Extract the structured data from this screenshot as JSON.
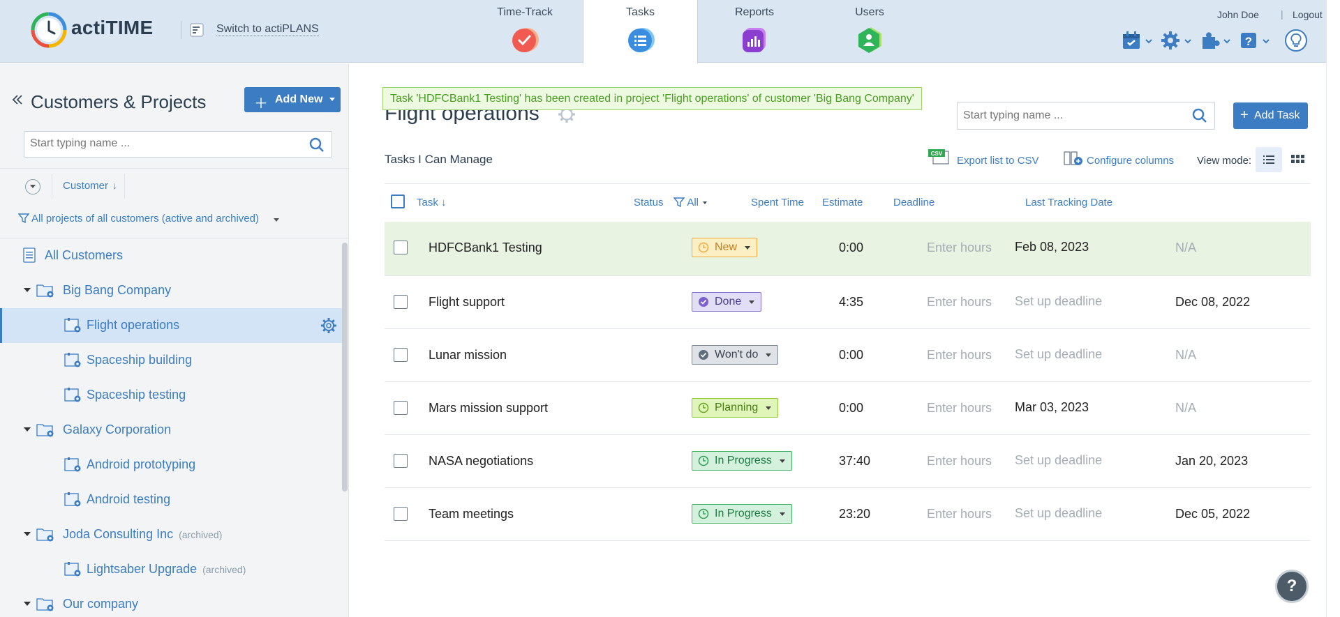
{
  "header": {
    "app_name": "actiTIME",
    "switch_link": "Switch to actiPLANS",
    "tabs": [
      {
        "label": "Time-Track",
        "color": "#f15a50"
      },
      {
        "label": "Tasks",
        "color": "#3b8de0"
      },
      {
        "label": "Reports",
        "color": "#8a3fd1"
      },
      {
        "label": "Users",
        "color": "#2fb45a"
      }
    ],
    "active_tab": "Tasks",
    "user_name": "John Doe",
    "separator": "|",
    "logout": "Logout",
    "tools": [
      "calendar-icon",
      "settings-icon",
      "addons-icon",
      "help-icon",
      "lightbulb-icon"
    ]
  },
  "sidebar": {
    "title": "Customers & Projects",
    "add_new": "Add New",
    "search_placeholder": "Start typing name ...",
    "sort_label": "Customer",
    "sort_arrow": "↓",
    "filter_label": "All projects of all customers (active and archived)",
    "tree": [
      {
        "label": "All Customers",
        "type": "all"
      },
      {
        "label": "Big Bang Company",
        "type": "customer"
      },
      {
        "label": "Flight operations",
        "type": "project",
        "selected": true
      },
      {
        "label": "Spaceship building",
        "type": "project"
      },
      {
        "label": "Spaceship testing",
        "type": "project"
      },
      {
        "label": "Galaxy Corporation",
        "type": "customer"
      },
      {
        "label": "Android prototyping",
        "type": "project"
      },
      {
        "label": "Android testing",
        "type": "project"
      },
      {
        "label": "Joda Consulting Inc",
        "type": "customer",
        "archived": "(archived)"
      },
      {
        "label": "Lightsaber Upgrade",
        "type": "project",
        "archived": "(archived)"
      },
      {
        "label": "Our company",
        "type": "customer"
      }
    ]
  },
  "main": {
    "page_title": "Flight operations",
    "toast": "Task 'HDFCBank1 Testing' has been created in project 'Flight operations' of customer 'Big Bang Company'",
    "search_placeholder": "Start typing name ...",
    "add_task": "Add Task",
    "list_title": "Tasks I Can Manage",
    "export_label": "Export list to CSV",
    "export_badge": "CSV",
    "configure_label": "Configure columns",
    "view_mode_label": "View mode:",
    "columns": {
      "task": "Task",
      "task_sort": "↓",
      "status": "Status",
      "status_filter": "All",
      "spent": "Spent Time",
      "estimate": "Estimate",
      "deadline": "Deadline",
      "last_tracking": "Last Tracking Date"
    },
    "rows": [
      {
        "task": "HDFCBank1 Testing",
        "status": "New",
        "status_kind": "new",
        "spent": "0:00",
        "estimate": "Enter hours",
        "deadline": "Feb 08, 2023",
        "last_tracking": "N/A",
        "highlight": true
      },
      {
        "task": "Flight support",
        "status": "Done",
        "status_kind": "done",
        "spent": "4:35",
        "estimate": "Enter hours",
        "deadline": "Set up deadline",
        "last_tracking": "Dec 08, 2022"
      },
      {
        "task": "Lunar mission",
        "status": "Won't do",
        "status_kind": "wont",
        "spent": "0:00",
        "estimate": "Enter hours",
        "deadline": "Set up deadline",
        "last_tracking": "N/A"
      },
      {
        "task": "Mars mission support",
        "status": "Planning",
        "status_kind": "plan",
        "spent": "0:00",
        "estimate": "Enter hours",
        "deadline": "Mar 03, 2023",
        "last_tracking": "N/A"
      },
      {
        "task": "NASA negotiations",
        "status": "In Progress",
        "status_kind": "prog",
        "spent": "37:40",
        "estimate": "Enter hours",
        "deadline": "Set up deadline",
        "last_tracking": "Jan 20, 2023"
      },
      {
        "task": "Team meetings",
        "status": "In Progress",
        "status_kind": "prog",
        "spent": "23:20",
        "estimate": "Enter hours",
        "deadline": "Set up deadline",
        "last_tracking": "Dec 05, 2022"
      }
    ],
    "help_button": "?"
  }
}
